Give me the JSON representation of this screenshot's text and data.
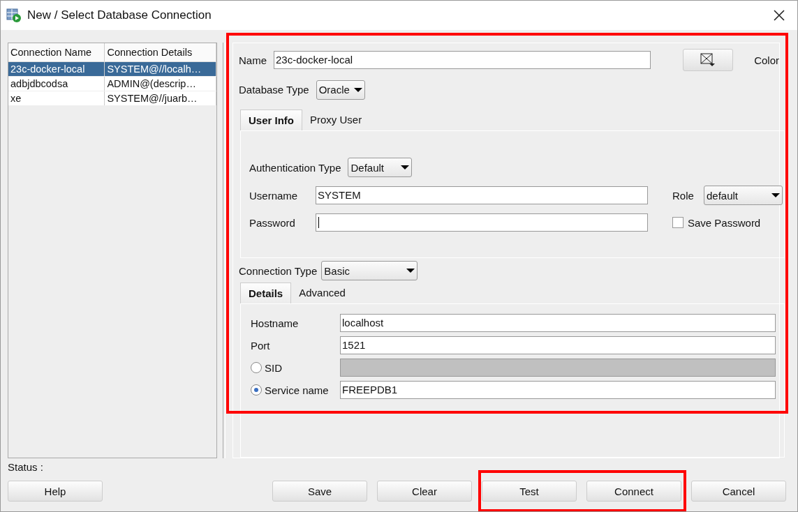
{
  "window": {
    "title": "New / Select Database Connection"
  },
  "connections": {
    "columns": [
      "Connection Name",
      "Connection Details"
    ],
    "rows": [
      {
        "name": "23c-docker-local",
        "details": "SYSTEM@//localh…",
        "selected": true
      },
      {
        "name": "adbjdbcodsa",
        "details": "ADMIN@(descrip…",
        "selected": false
      },
      {
        "name": "xe",
        "details": "SYSTEM@//juarb…",
        "selected": false
      }
    ]
  },
  "form": {
    "name": {
      "label": "Name",
      "value": "23c-docker-local"
    },
    "color_label": "Color",
    "database_type": {
      "label": "Database Type",
      "value": "Oracle"
    },
    "tabs": [
      {
        "label": "User Info",
        "selected": true
      },
      {
        "label": "Proxy User",
        "selected": false
      }
    ],
    "authentication_type": {
      "label": "Authentication Type",
      "value": "Default"
    },
    "username": {
      "label": "Username",
      "value": "SYSTEM"
    },
    "role": {
      "label": "Role",
      "value": "default"
    },
    "password": {
      "label": "Password"
    },
    "save_password": {
      "label": "Save Password",
      "checked": false
    },
    "connection_type": {
      "label": "Connection Type",
      "value": "Basic"
    },
    "detail_tabs": [
      {
        "label": "Details",
        "selected": true
      },
      {
        "label": "Advanced",
        "selected": false
      }
    ],
    "hostname": {
      "label": "Hostname",
      "value": "localhost"
    },
    "port": {
      "label": "Port",
      "value": "1521"
    },
    "sid": {
      "label": "SID",
      "selected": false,
      "disabled": true
    },
    "service_name": {
      "label": "Service name",
      "selected": true,
      "value": "FREEPDB1",
      "disabled": false
    }
  },
  "status_label": "Status :",
  "help_button": "Help",
  "buttons": [
    "Save",
    "Clear",
    "Test",
    "Connect",
    "Cancel"
  ]
}
